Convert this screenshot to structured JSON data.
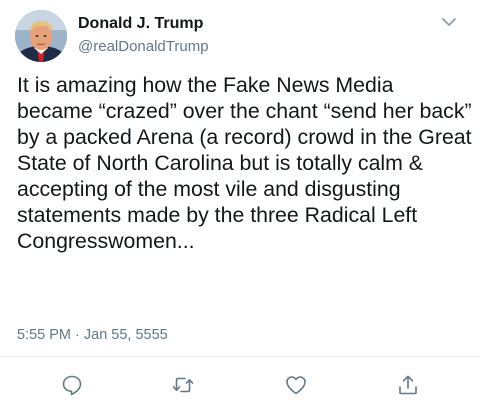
{
  "author": {
    "name": "Donald J. Trump",
    "handle": "@realDonaldTrump"
  },
  "tweet": {
    "text": "It is amazing how the Fake News Media became “crazed” over the chant “send her back” by a packed Arena (a record) crowd in the Great State of North Carolina but is totally calm & accepting of the most vile and disgusting statements made by the three Radical Left Congresswomen...",
    "timestamp": "5:55 PM · Jan 55, 5555"
  },
  "icons": {
    "menu": "chevron-down-icon",
    "reply": "reply-icon",
    "retweet": "retweet-icon",
    "like": "heart-icon",
    "share": "share-icon"
  },
  "colors": {
    "text": "#14171a",
    "secondary": "#657786",
    "divider": "#e6ecf0"
  }
}
